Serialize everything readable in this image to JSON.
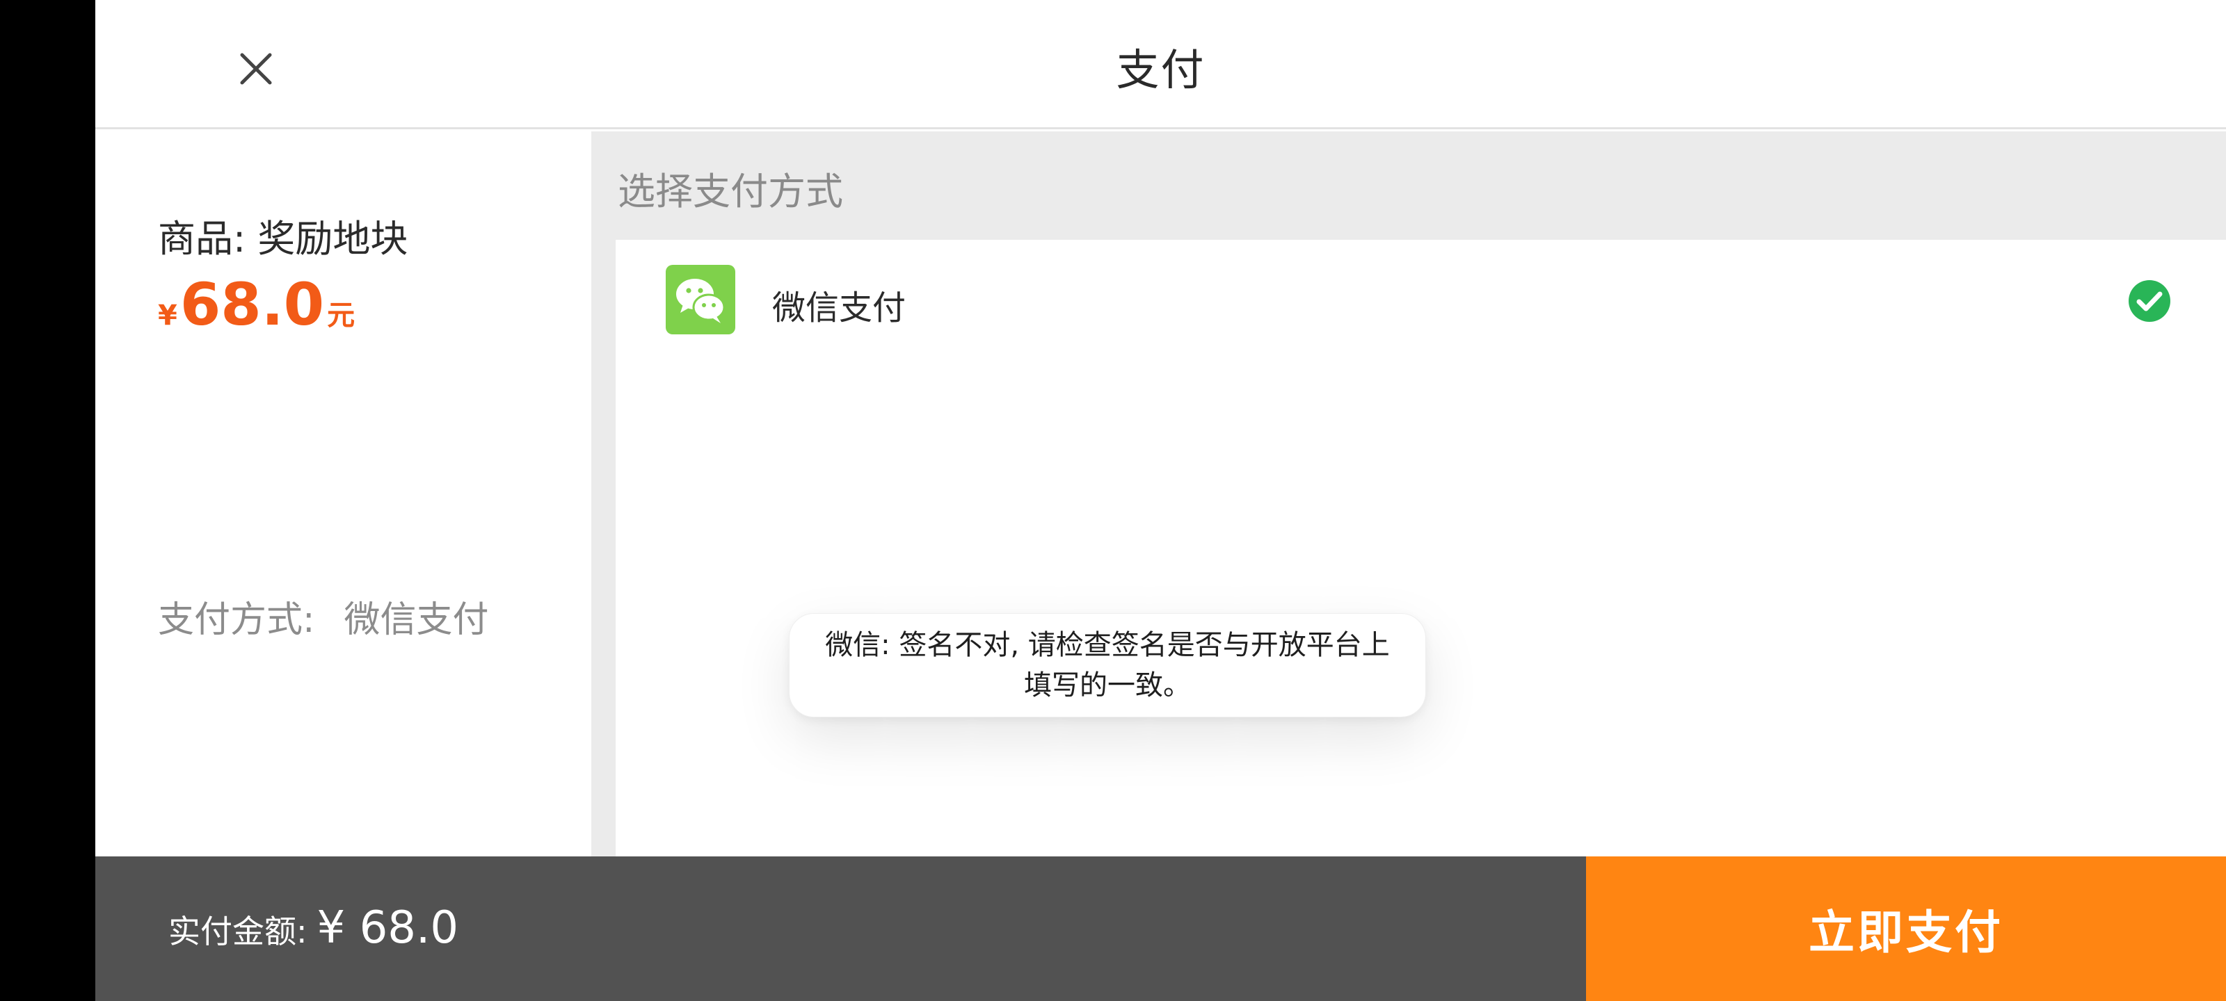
{
  "header": {
    "title": "支付"
  },
  "order": {
    "product_line": "商品: 奖励地块",
    "currency_symbol": "¥",
    "price": "68.0",
    "price_unit": "元",
    "method_label": "支付方式:",
    "method_value": "微信支付"
  },
  "payment_methods": {
    "section_title": "选择支付方式",
    "items": [
      {
        "label": "微信支付",
        "icon": "wechat-icon",
        "selected": true
      }
    ]
  },
  "toast": {
    "message": "微信: 签名不对, 请检查签名是否与开放平台上填写的一致。"
  },
  "footer": {
    "amount_label": "实付金额:",
    "amount_value": "¥ 68.0",
    "pay_button_label": "立即支付"
  },
  "colors": {
    "price": "#f25b17",
    "pay_button": "#ff8512",
    "footer_bg": "#525252",
    "wechat_green": "#7fd14b",
    "check_green": "#29b557"
  }
}
